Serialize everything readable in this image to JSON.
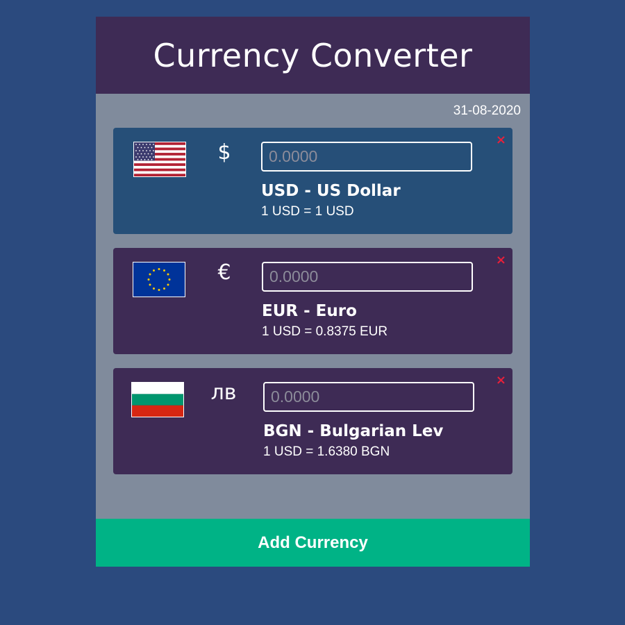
{
  "app": {
    "title": "Currency Converter",
    "date": "31-08-2020",
    "add_button_label": "Add Currency"
  },
  "currencies": [
    {
      "flag_icon": "us-flag-icon",
      "symbol": "$",
      "amount_value": "",
      "amount_placeholder": "0.0000",
      "name": "USD - US Dollar",
      "rate": "1 USD = 1 USD",
      "remove_label": "×",
      "is_base": true
    },
    {
      "flag_icon": "eu-flag-icon",
      "symbol": "€",
      "amount_value": "",
      "amount_placeholder": "0.0000",
      "name": "EUR - Euro",
      "rate": "1 USD = 0.8375 EUR",
      "remove_label": "×",
      "is_base": false
    },
    {
      "flag_icon": "bg-flag-icon",
      "symbol": "лв",
      "amount_value": "",
      "amount_placeholder": "0.0000",
      "name": "BGN - Bulgarian Lev",
      "rate": "1 USD = 1.6380 BGN",
      "remove_label": "×",
      "is_base": false
    }
  ],
  "colors": {
    "page_background": "#2b4a7e",
    "panel_background": "#808b9c",
    "header_background": "#3e2b55",
    "base_card": "#264f78",
    "card": "#3e2b55",
    "accent_button": "#00b386",
    "remove_icon": "#e8203a"
  }
}
